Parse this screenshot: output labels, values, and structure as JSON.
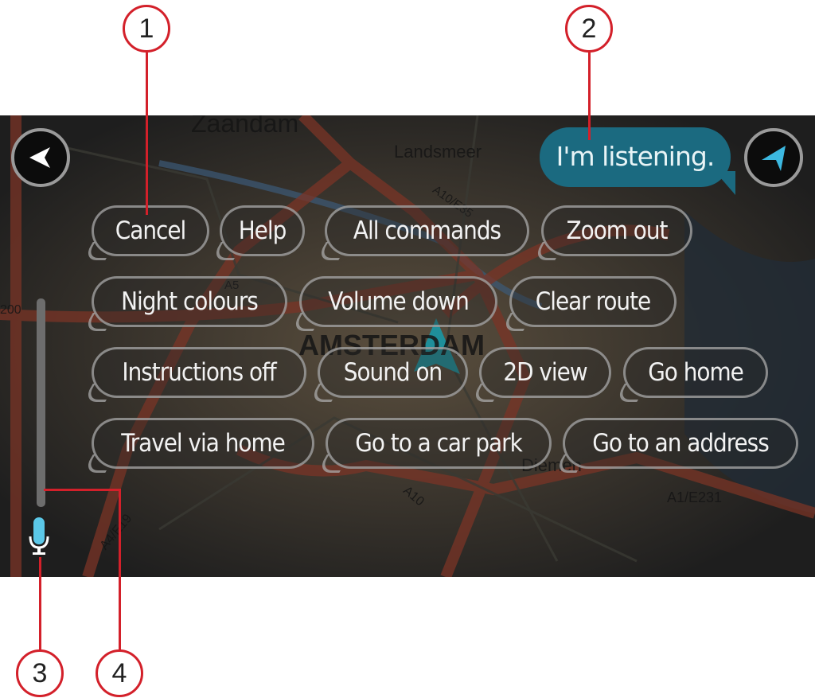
{
  "map": {
    "labels": [
      "Zaandam",
      "Landsmeer",
      "A10/E35",
      "A5",
      "200",
      "AMSTERDAM",
      "Diemen",
      "A10",
      "A1/E231",
      "A4/E19"
    ]
  },
  "header": {
    "back_icon": "back-arrow-icon",
    "status_text": "I'm listening.",
    "status_color": "#1b6a80",
    "nav_icon": "current-location-arrow-icon"
  },
  "commands": [
    "Cancel",
    "Help",
    "All commands",
    "Zoom out",
    "Night colours",
    "Volume down",
    "Clear route",
    "Instructions off",
    "Sound on",
    "2D view",
    "Go home",
    "Travel via home",
    "Go to a car park",
    "Go to an address"
  ],
  "mic": {
    "icon": "microphone-icon",
    "color": "#5bc8e8"
  },
  "callouts": [
    "1",
    "2",
    "3",
    "4"
  ],
  "accent_color": "#d3202a"
}
